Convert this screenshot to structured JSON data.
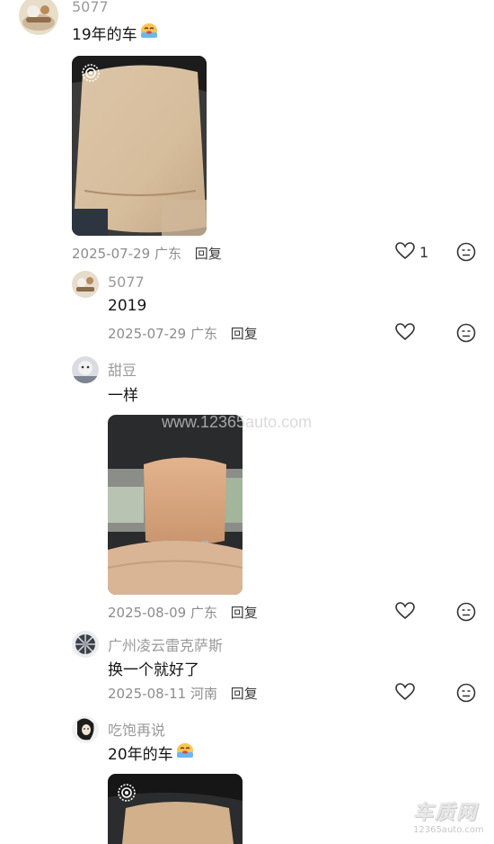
{
  "comments": [
    {
      "username": "5077",
      "text": "19年的车",
      "emoji": "crying-face-emoji",
      "date": "2025-07-29",
      "location": "广东",
      "reply": "回复",
      "like_count": "1"
    },
    {
      "username": "5077",
      "text": "2019",
      "date": "2025-07-29",
      "location": "广东",
      "reply": "回复"
    },
    {
      "username": "甜豆",
      "text": "一样",
      "date": "2025-08-09",
      "location": "广东",
      "reply": "回复"
    },
    {
      "username": "广州凌云雷克萨斯",
      "text": "换一个就好了",
      "date": "2025-08-11",
      "location": "河南",
      "reply": "回复"
    },
    {
      "username": "吃饱再说",
      "text": "20年的车",
      "emoji": "crying-face-emoji"
    }
  ],
  "watermark": {
    "center": "www.12365auto.com",
    "corner_logo": "车质网",
    "corner_url": "12365auto.com"
  },
  "icons": {
    "like": "heart-outline-icon",
    "dislike": "meh-face-icon",
    "live_photo": "live-photo-icon"
  },
  "colors": {
    "text": "#151515",
    "meta": "#8c8c8c",
    "username": "#9a9a9a"
  }
}
